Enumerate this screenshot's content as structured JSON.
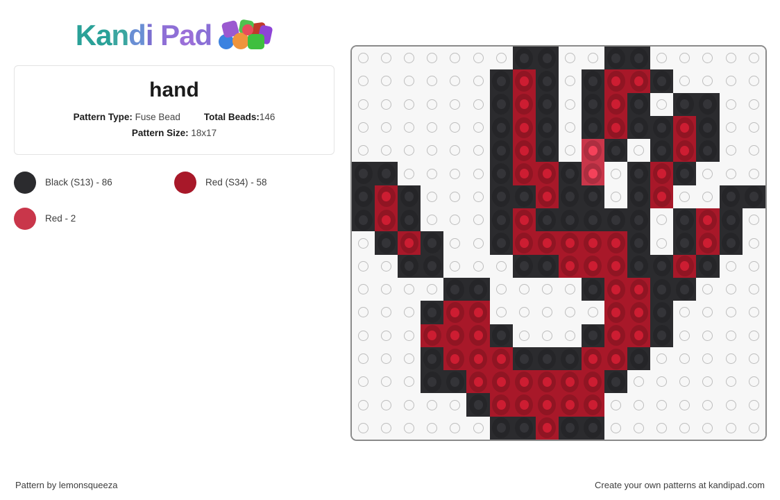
{
  "brand": {
    "name_parts": [
      "K",
      "a",
      "n",
      "d",
      "i",
      " ",
      "P",
      "a",
      "d"
    ],
    "name": "Kandi Pad",
    "logo_icon": "kandi-beads-icon"
  },
  "pattern": {
    "title": "hand",
    "type_label": "Pattern Type:",
    "type_value": "Fuse Bead",
    "total_label": "Total Beads:",
    "total_value": "146",
    "size_label": "Pattern Size:",
    "size_value": "18x17",
    "columns": 18,
    "rows": 17
  },
  "legend": [
    {
      "label": "Black (S13) - 86",
      "color": "#2b2b2e",
      "name": "Black (S13)",
      "count": 86,
      "key": "K"
    },
    {
      "label": "Red (S34) - 58",
      "color": "#a81829",
      "name": "Red (S34)",
      "count": 58,
      "key": "R"
    },
    {
      "label": "Red - 2",
      "color": "#c9364a",
      "name": "Red",
      "count": 2,
      "key": "L"
    }
  ],
  "colors": {
    "empty": "#f7f7f7",
    "empty_ring": "#bdbdbd",
    "black": "#2b2b2e",
    "red": "#a81829",
    "light_red": "#c9364a",
    "panel_border": "#8a8a8a"
  },
  "grid": {
    "legend_map": {
      ".": "empty",
      "K": "#2b2b2e",
      "R": "#a81829",
      "L": "#c9364a"
    },
    "rows": [
      ".......KK..KK.....",
      "......KRK.KRRK....",
      "......KRK.KRK.KK..",
      "......KRK.KRKKRK..",
      "......KRK.LK.KRK..",
      "KK....KRRKL.KRK...",
      "KRK...KKRKK.KR..KK",
      "KRK...KRKKKKK.KRK.",
      ".KRK..KRRRRRK.KRK.",
      "..KK...KKRRRKKRK..",
      "....KK....KRRKK...",
      "...KRR.....RRK....",
      "...RRRK...KRRK....",
      "...KRRRKKKRRK.....",
      "...KKRRRRRRK......",
      ".....KRRRRR.......",
      "......KKRKK......."
    ]
  },
  "footer": {
    "left": "Pattern by lemonsqueeza",
    "right": "Create your own patterns at kandipad.com"
  }
}
